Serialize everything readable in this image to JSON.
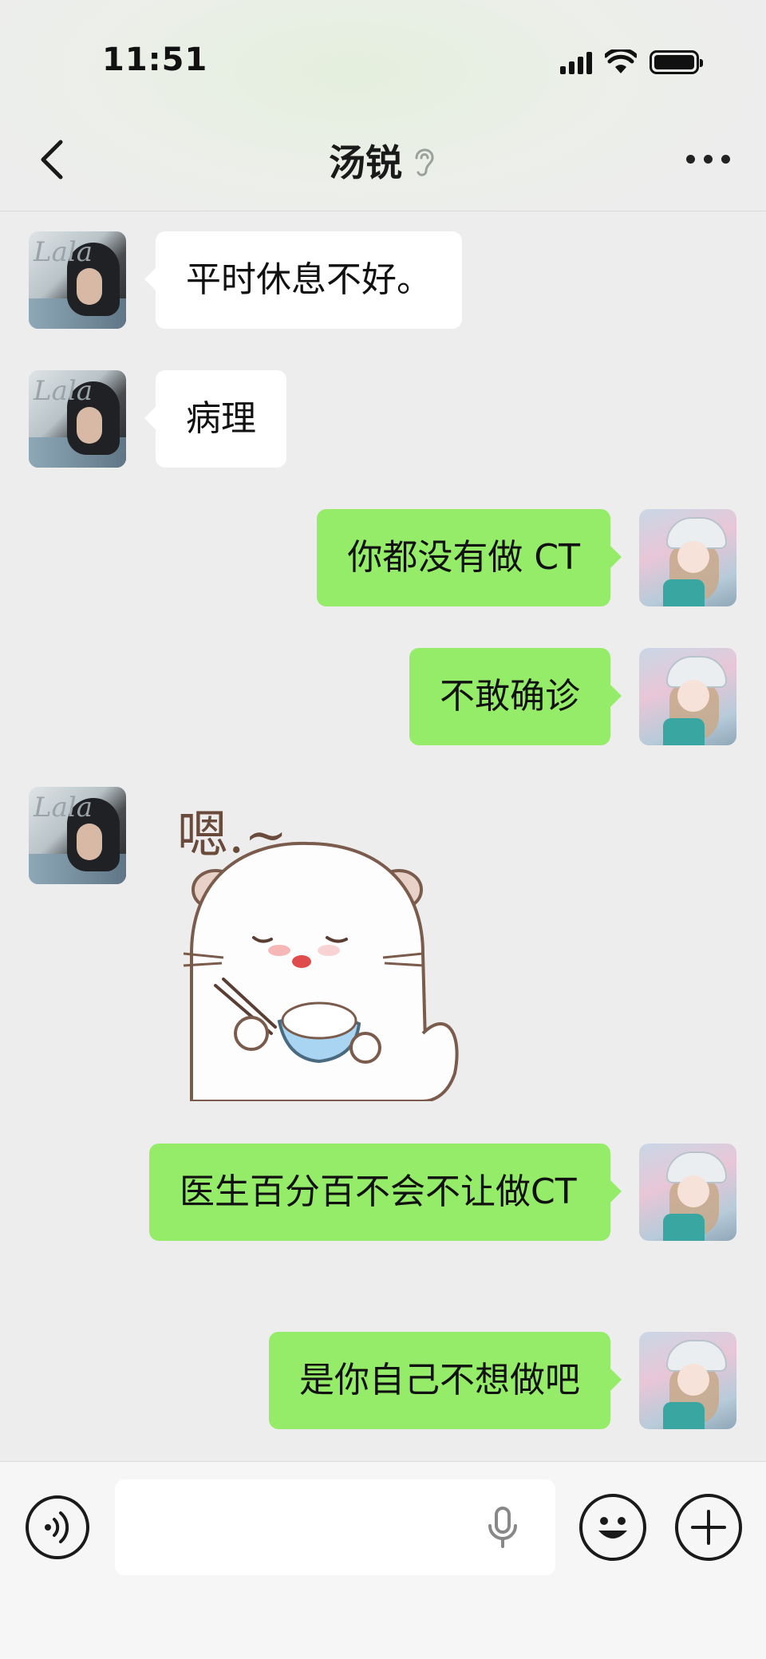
{
  "status_bar": {
    "time": "11:51"
  },
  "header": {
    "title": "汤锐"
  },
  "messages": [
    {
      "side": "in",
      "text": "平时休息不好。"
    },
    {
      "side": "in",
      "text": "病理"
    },
    {
      "side": "out",
      "text": "你都没有做 CT"
    },
    {
      "side": "out",
      "text": "不敢确诊"
    },
    {
      "side": "in",
      "type": "sticker",
      "sticker_text": "嗯.~"
    },
    {
      "side": "out",
      "text": "医生百分百不会不让做CT"
    },
    {
      "side": "out",
      "text": "是你自己不想做吧"
    }
  ],
  "avatars": {
    "left_lettering": "Lala"
  },
  "colors": {
    "outgoing_bubble": "#95ec69",
    "incoming_bubble": "#ffffff",
    "background": "#ededed"
  },
  "icons": {
    "back": "chevron-left-icon",
    "listen_mode": "ear-icon",
    "more": "more-dots-icon",
    "voice": "voice-icon",
    "mic": "mic-icon",
    "emoji": "emoji-icon",
    "plus": "plus-icon"
  }
}
